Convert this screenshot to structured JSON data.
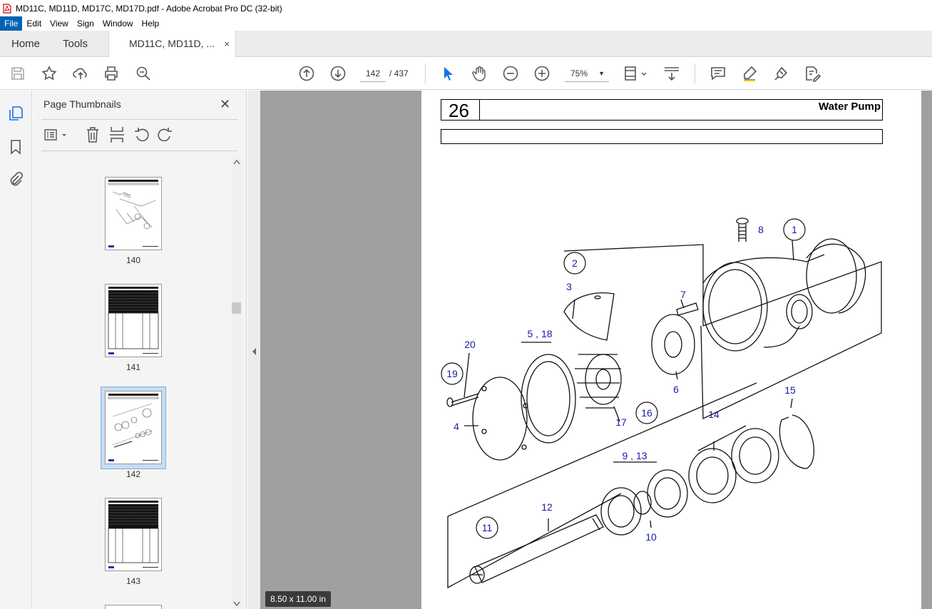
{
  "window": {
    "title": "MD11C, MD11D, MD17C, MD17D.pdf - Adobe Acrobat Pro DC (32-bit)"
  },
  "menu": [
    "File",
    "Edit",
    "View",
    "Sign",
    "Window",
    "Help"
  ],
  "tabs": {
    "home": "Home",
    "tools": "Tools",
    "document": "MD11C, MD11D, ...",
    "close": "×"
  },
  "toolbar": {
    "page_current": "142",
    "page_total": "/  437",
    "zoom": "75%"
  },
  "panel": {
    "title": "Page Thumbnails",
    "close": "✕"
  },
  "thumbnails": [
    {
      "label": "140",
      "selected": false
    },
    {
      "label": "141",
      "selected": false
    },
    {
      "label": "142",
      "selected": true
    },
    {
      "label": "143",
      "selected": false
    }
  ],
  "document": {
    "page_number": "26",
    "section_title": "Water Pump",
    "page_size": "8.50 x 11.00 in",
    "callouts": [
      "1",
      "2",
      "3",
      "4",
      "5 , 18",
      "6",
      "7",
      "8",
      "9 , 13",
      "10",
      "11",
      "12",
      "14",
      "15",
      "16",
      "17",
      "19",
      "20"
    ]
  },
  "colors": {
    "accent": "#0063b1",
    "callout": "#1a1aa8",
    "viewer_bg": "#a0a0a0"
  }
}
